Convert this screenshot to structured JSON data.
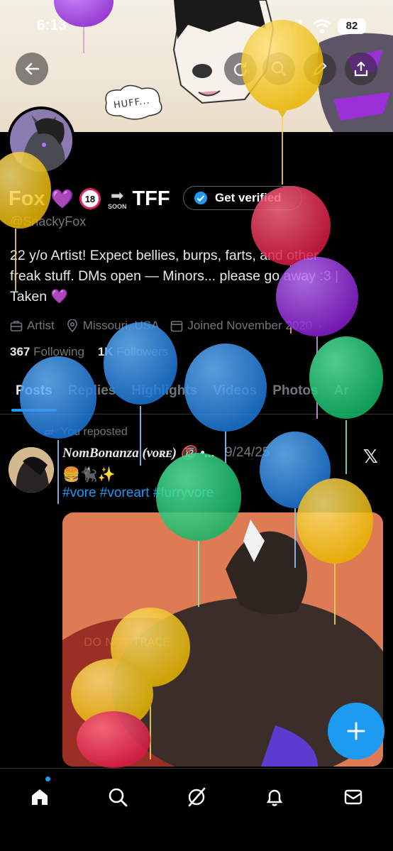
{
  "status_bar": {
    "time": "6:13",
    "battery": "82"
  },
  "profile": {
    "name": "Fox",
    "heart": "💜",
    "age_badge": "18",
    "soon_label": "SOON",
    "name_suffix": "TFF",
    "verify_label": "Get verified",
    "handle": "@SnackyFox",
    "bio_line1": "22 y/o Artist! Expect bellies, burps, farts, and other",
    "bio_line2": "freak stuff. DMs open — Minors... please go away :3 |",
    "bio_line3": "Taken 💜",
    "meta": {
      "category": "Artist",
      "location": "Missouri, USA",
      "joined": "Joined November 2020"
    },
    "following_count": "367",
    "following_label": "Following",
    "followers_count": "1K",
    "followers_label": "Followers"
  },
  "tabs": [
    "Posts",
    "Replies",
    "Highlights",
    "Videos",
    "Photos",
    "Ar"
  ],
  "post": {
    "repost_label": "You reposted",
    "author": "NomBonanza (ᴠᴏʀᴇ) 🔞 •...",
    "date": "9/24/25",
    "emojis": "🍔🐈‍⬛✨",
    "tags": "#vore #voreart #furryvore",
    "watermark": "DO NOT TRACE"
  },
  "banner": {
    "huff_text": "HUFF..."
  },
  "icons": {
    "back": "arrow-left-icon",
    "refresh": "refresh-icon",
    "search": "search-icon",
    "edit": "pencil-icon",
    "share": "share-icon",
    "home": "home-icon",
    "explore": "search-icon",
    "grok": "grok-icon",
    "notifications": "bell-icon",
    "messages": "mail-icon",
    "compose": "plus-icon"
  },
  "colors": {
    "accent": "#1d9bf0",
    "background": "#000000",
    "muted": "#71767b"
  }
}
